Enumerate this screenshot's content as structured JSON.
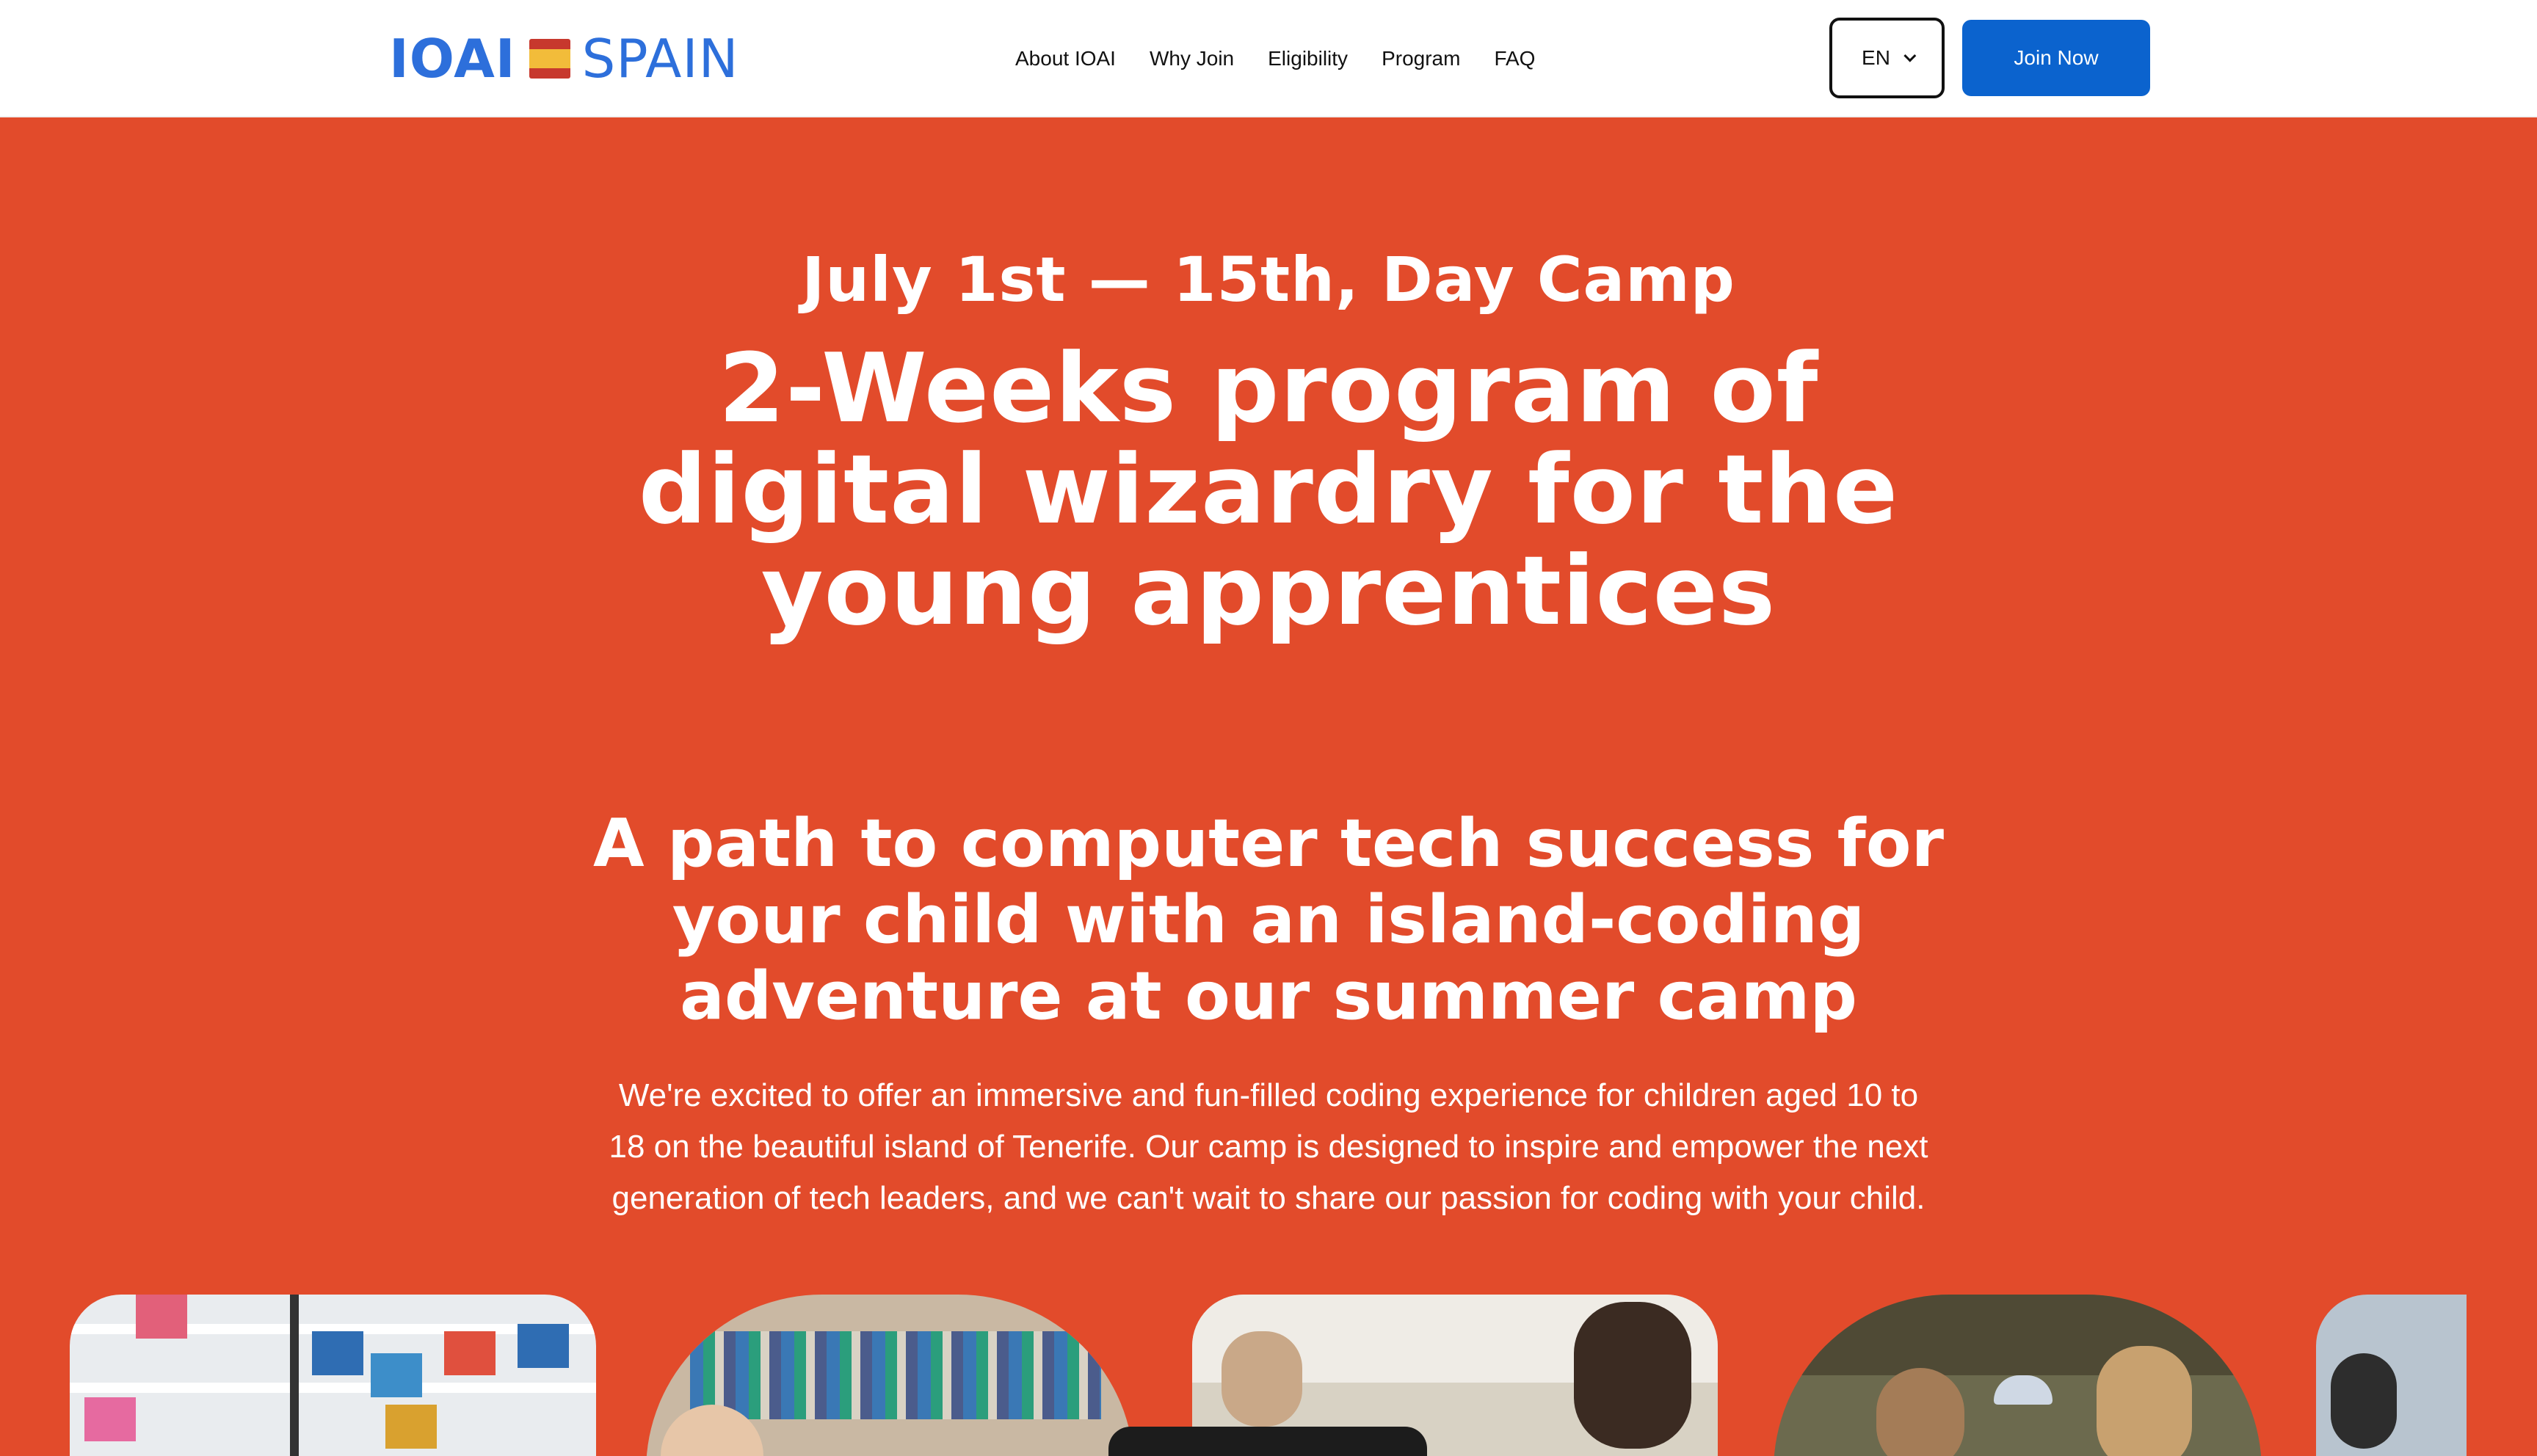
{
  "header": {
    "logo_left": "IOAI",
    "logo_right": "SPAIN",
    "nav": [
      "About IOAI",
      "Why Join",
      "Eligibility",
      "Program",
      "FAQ"
    ],
    "language": "EN",
    "cta": "Join Now"
  },
  "hero": {
    "date": "July 1st — 15th, Day Camp",
    "headline": "2-Weeks program of digital wizardry for the young apprentices",
    "subheadline": "A path to computer tech success for your child with an island-coding adventure at our summer camp",
    "description": "We're excited to offer an immersive and fun-filled coding experience for children aged 10 to 18 on the beautiful island of Tenerife. Our camp is designed to inspire and empower the next generation of tech leaders, and we can't wait to share our passion for coding with your child."
  },
  "colors": {
    "hero_background": "#e24b2b",
    "brand_blue": "#2d6fdb",
    "cta_blue": "#0b63ce"
  }
}
